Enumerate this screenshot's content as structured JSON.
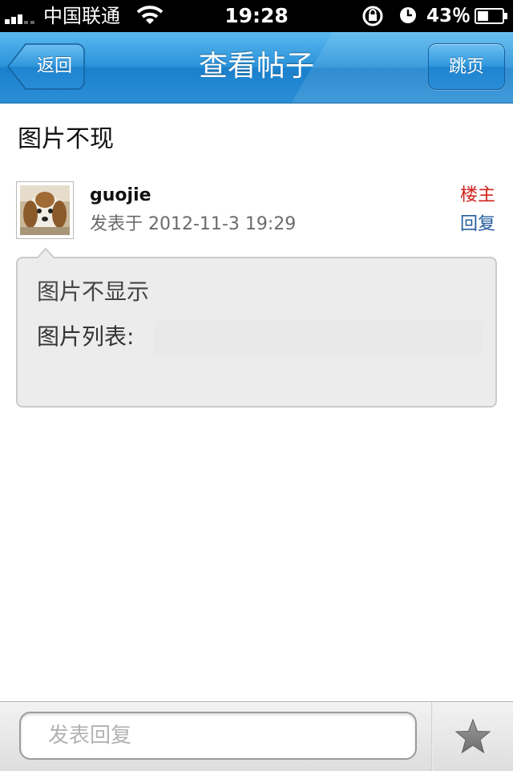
{
  "status_bar": {
    "carrier": "中国联通",
    "time": "19:28",
    "battery_percent": "43％",
    "battery_level": 0.43,
    "icons": [
      "signal-icon",
      "wifi-icon",
      "rotation-lock-icon",
      "alarm-clock-icon",
      "battery-icon"
    ]
  },
  "nav": {
    "back_label": "返回",
    "title": "查看帖子",
    "jump_label": "跳页",
    "colors": {
      "bar": "#2a93da",
      "bar_dark": "#1768a8"
    }
  },
  "post": {
    "title": "图片不现",
    "author": "guojie",
    "posted_at": "发表于 2012-11-3 19:29",
    "op_badge": "楼主",
    "reply_label": "回复",
    "body": "图片不显示",
    "image_list_label": "图片列表:",
    "colors": {
      "op_badge": "#d0221b",
      "reply_link": "#245d9c"
    }
  },
  "bottom_bar": {
    "reply_placeholder": "发表回复",
    "favorite_icon": "star-icon"
  }
}
